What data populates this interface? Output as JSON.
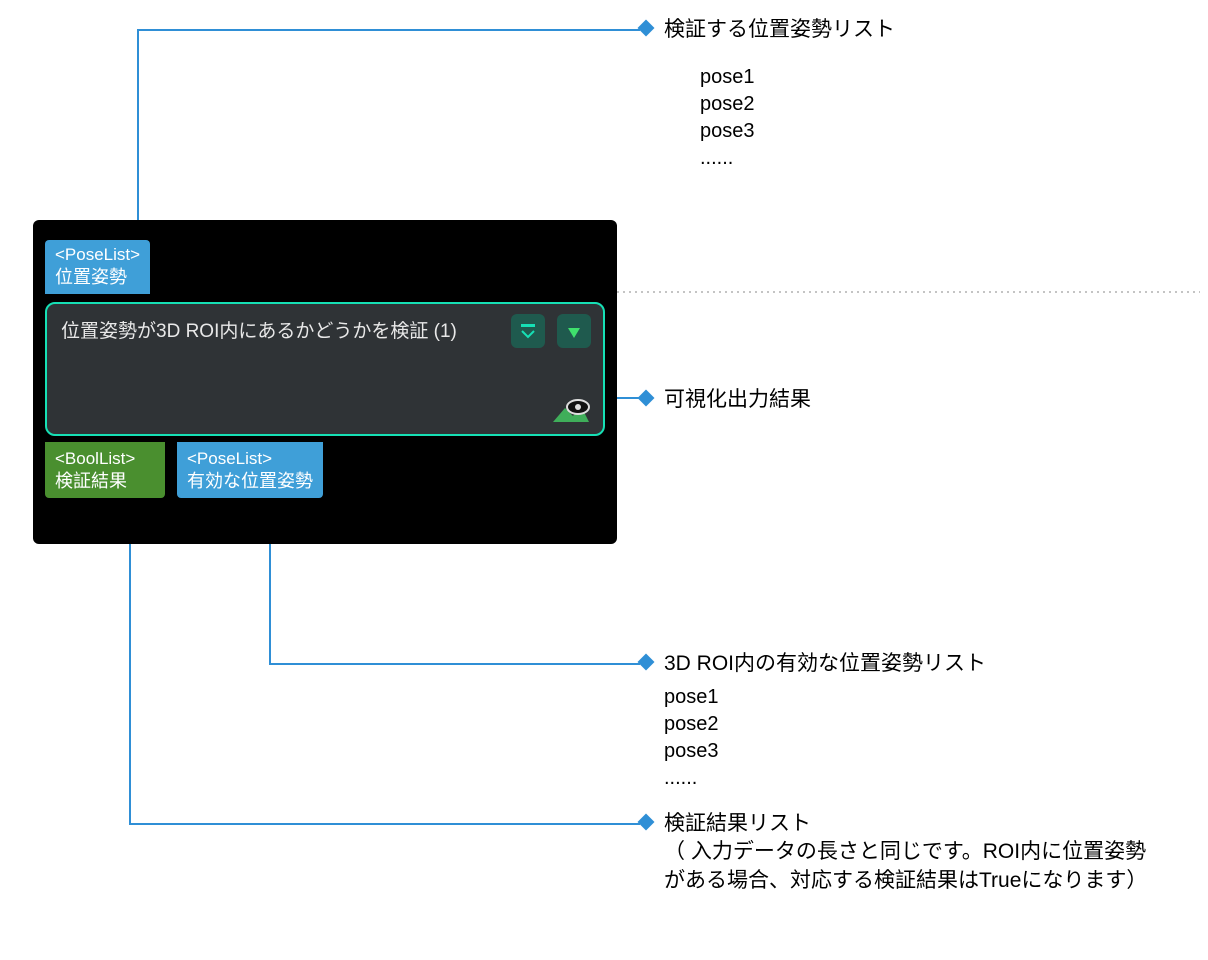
{
  "annotations": {
    "top": {
      "title": "検証する位置姿勢リスト",
      "items": "pose1\npose2\npose3\n......"
    },
    "vis": {
      "title": "可視化出力結果"
    },
    "valid": {
      "title": "3D  ROI内の有効な位置姿勢リスト",
      "items": "pose1\npose2\npose3\n......"
    },
    "result": {
      "title": "検証結果リスト",
      "detail": "（ 入力データの長さと同じです。ROI内に位置姿勢がある場合、対応する検証結果はTrueになります）"
    }
  },
  "node": {
    "input": {
      "type": "<PoseList>",
      "label": "位置姿勢"
    },
    "title": "位置姿勢が3D ROI内にあるかどうかを検証 (1)",
    "output1": {
      "type": "<BoolList>",
      "label": "検証結果"
    },
    "output2": {
      "type": "<PoseList>",
      "label": "有効な位置姿勢"
    }
  },
  "colors": {
    "connector": "#2f8fd6",
    "teal": "#16e0b5"
  }
}
